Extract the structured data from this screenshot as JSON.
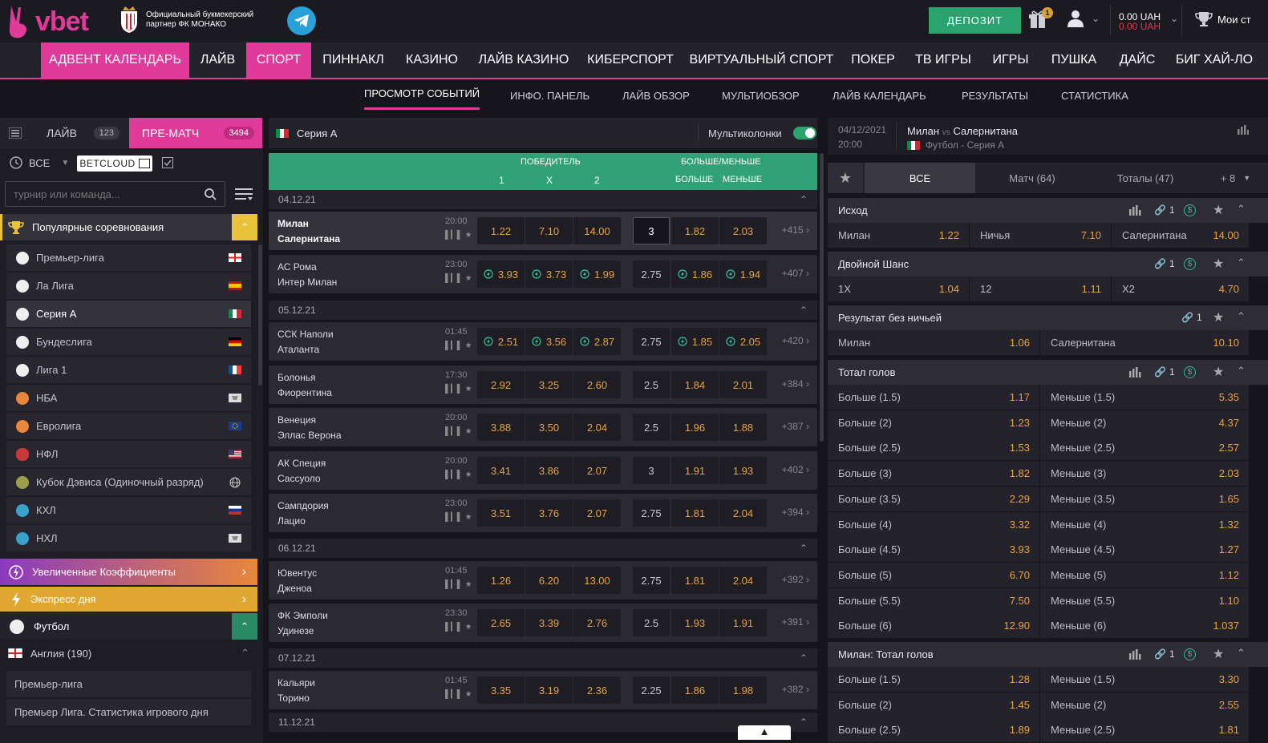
{
  "header": {
    "logo_text": "vbet",
    "partner_text": "Официальный букмекерский партнер ФК МОНАКО",
    "deposit": "ДЕПОЗИТ",
    "gift_badge": "1",
    "balance_main": "0.00 UAH",
    "balance_bonus": "0.00 UAH",
    "my_bets": "Мои ст"
  },
  "nav": [
    "АДВЕНТ КАЛЕНДАРЬ",
    "ЛАЙВ",
    "СПОРТ",
    "ПИННАКЛ",
    "КАЗИНО",
    "ЛАЙВ КАЗИНО",
    "КИБЕРСПОРТ",
    "ВИРТУАЛЬНЫЙ СПОРТ",
    "ПОКЕР",
    "ТВ ИГРЫ",
    "ИГРЫ",
    "ПУШКА",
    "ДАЙС",
    "БИГ ХАЙ-ЛО"
  ],
  "subnav": [
    "ПРОСМОТР СОБЫТИЙ",
    "ИНФО. ПАНЕЛЬ",
    "ЛАЙВ ОБЗОР",
    "МУЛЬТИОБЗОР",
    "ЛАЙВ КАЛЕНДАРЬ",
    "РЕЗУЛЬТАТЫ",
    "СТАТИСТИКА"
  ],
  "left": {
    "live_tab": "ЛАЙВ",
    "live_count": "123",
    "prematch_tab": "ПРЕ-МАТЧ",
    "prematch_count": "3494",
    "all": "ВСЕ",
    "betcloud": "BETCLOUD",
    "search_placeholder": "турнир или команда...",
    "popular": "Популярные соревнования",
    "competitions": [
      "Премьер-лига",
      "Ла Лига",
      "Серия А",
      "Бундеслига",
      "Лига 1",
      "НБА",
      "Евролига",
      "НФЛ",
      "Кубок Дэвиса (Одиночный разряд)",
      "КХЛ",
      "НХЛ"
    ],
    "boosted": "Увеличенные Коэффициенты",
    "express": "Экспресс дня",
    "football": "Футбол",
    "england": "Англия (190)",
    "sub_items": [
      "Премьер-лига",
      "Премьер Лига. Статистика игрового дня"
    ]
  },
  "center": {
    "league": "Серия А",
    "multicolumn": "Мультиколонки",
    "market_winner": "ПОБЕДИТЕЛЬ",
    "market_total": "БОЛЬШЕ/МЕНЬШЕ",
    "col1": "1",
    "colx": "X",
    "col2": "2",
    "over": "БОЛЬШЕ",
    "under": "МЕНЬШЕ",
    "groups": [
      {
        "date": "04.12.21",
        "matches": [
          {
            "home": "Милан",
            "away": "Салернитана",
            "time": "20:00",
            "o1": "1.22",
            "ox": "7.10",
            "o2": "14.00",
            "h": "3",
            "ov": "1.82",
            "un": "2.03",
            "more": "+415"
          }
        ]
      },
      {
        "date": "",
        "matches": [
          {
            "home": "АС Рома",
            "away": "Интер Милан",
            "time": "23:00",
            "o1": "3.93",
            "ox": "3.73",
            "o2": "1.99",
            "h": "2.75",
            "ov": "1.86",
            "un": "1.94",
            "more": "+407"
          }
        ]
      },
      {
        "date": "05.12.21",
        "matches": [
          {
            "home": "ССК Наполи",
            "away": "Аталанта",
            "time": "01:45",
            "o1": "2.51",
            "ox": "3.56",
            "o2": "2.87",
            "h": "2.75",
            "ov": "1.85",
            "un": "2.05",
            "more": "+420"
          },
          {
            "home": "Болонья",
            "away": "Фиорентина",
            "time": "17:30",
            "o1": "2.92",
            "ox": "3.25",
            "o2": "2.60",
            "h": "2.5",
            "ov": "1.84",
            "un": "2.01",
            "more": "+384"
          },
          {
            "home": "Венеция",
            "away": "Эллас Верона",
            "time": "20:00",
            "o1": "3.88",
            "ox": "3.50",
            "o2": "2.04",
            "h": "2.5",
            "ov": "1.96",
            "un": "1.88",
            "more": "+387"
          },
          {
            "home": "АК Специя",
            "away": "Сассуоло",
            "time": "20:00",
            "o1": "3.41",
            "ox": "3.86",
            "o2": "2.07",
            "h": "3",
            "ov": "1.91",
            "un": "1.93",
            "more": "+402"
          },
          {
            "home": "Сампдория",
            "away": "Лацио",
            "time": "23:00",
            "o1": "3.51",
            "ox": "3.76",
            "o2": "2.07",
            "h": "2.75",
            "ov": "1.81",
            "un": "2.04",
            "more": "+394"
          }
        ]
      },
      {
        "date": "06.12.21",
        "matches": [
          {
            "home": "Ювентус",
            "away": "Дженоа",
            "time": "01:45",
            "o1": "1.26",
            "ox": "6.20",
            "o2": "13.00",
            "h": "2.75",
            "ov": "1.81",
            "un": "2.04",
            "more": "+392"
          },
          {
            "home": "ФК Эмполи",
            "away": "Удинезе",
            "time": "23:30",
            "o1": "2.65",
            "ox": "3.39",
            "o2": "2.76",
            "h": "2.5",
            "ov": "1.93",
            "un": "1.91",
            "more": "+391"
          }
        ]
      },
      {
        "date": "07.12.21",
        "matches": [
          {
            "home": "Кальяри",
            "away": "Торино",
            "time": "01:45",
            "o1": "3.35",
            "ox": "3.19",
            "o2": "2.36",
            "h": "2.25",
            "ov": "1.86",
            "un": "1.98",
            "more": "+382"
          }
        ]
      },
      {
        "date": "11.12.21",
        "matches": []
      }
    ]
  },
  "right": {
    "date": "04/12/2021",
    "time": "20:00",
    "home": "Милан",
    "vs": "vs",
    "away": "Салернитана",
    "league": "Футбол - Серия А",
    "tab_all": "ВСЕ",
    "tab_match": "Матч (64)",
    "tab_totals": "Тоталы (47)",
    "tab_more": "+ 8",
    "outcome": "Исход",
    "outcome_row": [
      [
        "Милан",
        "1.22"
      ],
      [
        "Ничья",
        "7.10"
      ],
      [
        "Салернитана",
        "14.00"
      ]
    ],
    "double": "Двойной Шанс",
    "double_row": [
      [
        "1X",
        "1.04"
      ],
      [
        "12",
        "1.11"
      ],
      [
        "X2",
        "4.70"
      ]
    ],
    "nodraw": "Результат без ничьей",
    "nodraw_row": [
      [
        "Милан",
        "1.06"
      ],
      [
        "Салернитана",
        "10.10"
      ]
    ],
    "total": "Тотал голов",
    "total_rows": [
      [
        "Больше (1.5)",
        "1.17",
        "Меньше (1.5)",
        "5.35"
      ],
      [
        "Больше (2)",
        "1.23",
        "Меньше (2)",
        "4.37"
      ],
      [
        "Больше (2.5)",
        "1.53",
        "Меньше (2.5)",
        "2.57"
      ],
      [
        "Больше (3)",
        "1.82",
        "Меньше (3)",
        "2.03"
      ],
      [
        "Больше (3.5)",
        "2.29",
        "Меньше (3.5)",
        "1.65"
      ],
      [
        "Больше (4)",
        "3.32",
        "Меньше (4)",
        "1.32"
      ],
      [
        "Больше (4.5)",
        "3.93",
        "Меньше (4.5)",
        "1.27"
      ],
      [
        "Больше (5)",
        "6.70",
        "Меньше (5)",
        "1.12"
      ],
      [
        "Больше (5.5)",
        "7.50",
        "Меньше (5.5)",
        "1.10"
      ],
      [
        "Больше (6)",
        "12.90",
        "Меньше (6)",
        "1.037"
      ]
    ],
    "milan_total": "Милан: Тотал голов",
    "milan_rows": [
      [
        "Больше (1.5)",
        "1.28",
        "Меньше (1.5)",
        "3.30"
      ],
      [
        "Больше (2)",
        "1.45",
        "Меньше (2)",
        "2.55"
      ],
      [
        "Больше (2.5)",
        "1.89",
        "Меньше (2.5)",
        "1.81"
      ]
    ],
    "link_count": "1"
  },
  "colors": {
    "accent": "#e23a9b",
    "green": "#31a178",
    "odds": "#e8a33a"
  }
}
